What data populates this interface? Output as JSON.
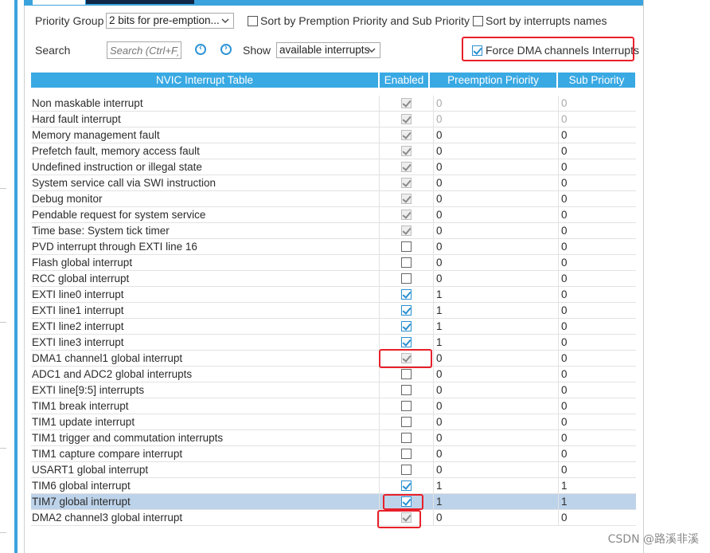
{
  "toolbar": {
    "priority_group_label": "Priority Group",
    "priority_group_value": "2 bits for pre-emption...",
    "sort_priority_label": "Sort by Premption Priority and Sub Priority",
    "sort_priority_checked": false,
    "sort_names_label": "Sort by interrupts names",
    "sort_names_checked": false,
    "search_label": "Search",
    "search_placeholder": "Search (Ctrl+F)",
    "show_label": "Show",
    "show_value": "available interrupts",
    "force_dma_label": "Force DMA channels Interrupts",
    "force_dma_checked": true
  },
  "table": {
    "headers": [
      "NVIC Interrupt Table",
      "Enabled",
      "Preemption Priority",
      "Sub Priority"
    ],
    "rows": [
      {
        "name": "Non maskable interrupt",
        "enabled": "locked",
        "pre": "0",
        "sub": "0",
        "dim": true
      },
      {
        "name": "Hard fault interrupt",
        "enabled": "locked",
        "pre": "0",
        "sub": "0",
        "dim": true
      },
      {
        "name": "Memory management fault",
        "enabled": "locked",
        "pre": "0",
        "sub": "0"
      },
      {
        "name": "Prefetch fault, memory access fault",
        "enabled": "locked",
        "pre": "0",
        "sub": "0"
      },
      {
        "name": "Undefined instruction or illegal state",
        "enabled": "locked",
        "pre": "0",
        "sub": "0"
      },
      {
        "name": "System service call via SWI instruction",
        "enabled": "locked",
        "pre": "0",
        "sub": "0"
      },
      {
        "name": "Debug monitor",
        "enabled": "locked",
        "pre": "0",
        "sub": "0"
      },
      {
        "name": "Pendable request for system service",
        "enabled": "locked",
        "pre": "0",
        "sub": "0"
      },
      {
        "name": "Time base: System tick timer",
        "enabled": "locked",
        "pre": "0",
        "sub": "0"
      },
      {
        "name": "PVD interrupt through EXTI line 16",
        "enabled": "off",
        "pre": "0",
        "sub": "0"
      },
      {
        "name": "Flash global interrupt",
        "enabled": "off",
        "pre": "0",
        "sub": "0"
      },
      {
        "name": "RCC global interrupt",
        "enabled": "off",
        "pre": "0",
        "sub": "0"
      },
      {
        "name": "EXTI line0 interrupt",
        "enabled": "on",
        "pre": "1",
        "sub": "0"
      },
      {
        "name": "EXTI line1 interrupt",
        "enabled": "on",
        "pre": "1",
        "sub": "0"
      },
      {
        "name": "EXTI line2 interrupt",
        "enabled": "on",
        "pre": "1",
        "sub": "0"
      },
      {
        "name": "EXTI line3 interrupt",
        "enabled": "on",
        "pre": "1",
        "sub": "0"
      },
      {
        "name": "DMA1 channel1 global interrupt",
        "enabled": "locked",
        "pre": "0",
        "sub": "0"
      },
      {
        "name": "ADC1 and ADC2 global interrupts",
        "enabled": "off",
        "pre": "0",
        "sub": "0"
      },
      {
        "name": "EXTI line[9:5] interrupts",
        "enabled": "off",
        "pre": "0",
        "sub": "0"
      },
      {
        "name": "TIM1 break interrupt",
        "enabled": "off",
        "pre": "0",
        "sub": "0"
      },
      {
        "name": "TIM1 update interrupt",
        "enabled": "off",
        "pre": "0",
        "sub": "0"
      },
      {
        "name": "TIM1 trigger and commutation interrupts",
        "enabled": "off",
        "pre": "0",
        "sub": "0"
      },
      {
        "name": "TIM1 capture compare interrupt",
        "enabled": "off",
        "pre": "0",
        "sub": "0"
      },
      {
        "name": "USART1 global interrupt",
        "enabled": "off",
        "pre": "0",
        "sub": "0"
      },
      {
        "name": "TIM6 global interrupt",
        "enabled": "on",
        "pre": "1",
        "sub": "1"
      },
      {
        "name": "TIM7 global interrupt",
        "enabled": "on",
        "pre": "1",
        "sub": "1",
        "selected": true
      },
      {
        "name": "DMA2 channel3 global interrupt",
        "enabled": "locked",
        "pre": "0",
        "sub": "0"
      }
    ]
  },
  "watermark": "CSDN @路溪非溪",
  "colors": {
    "accent": "#39a9e3",
    "highlight": "#e8202a",
    "selected_row": "#bdd3ea"
  }
}
